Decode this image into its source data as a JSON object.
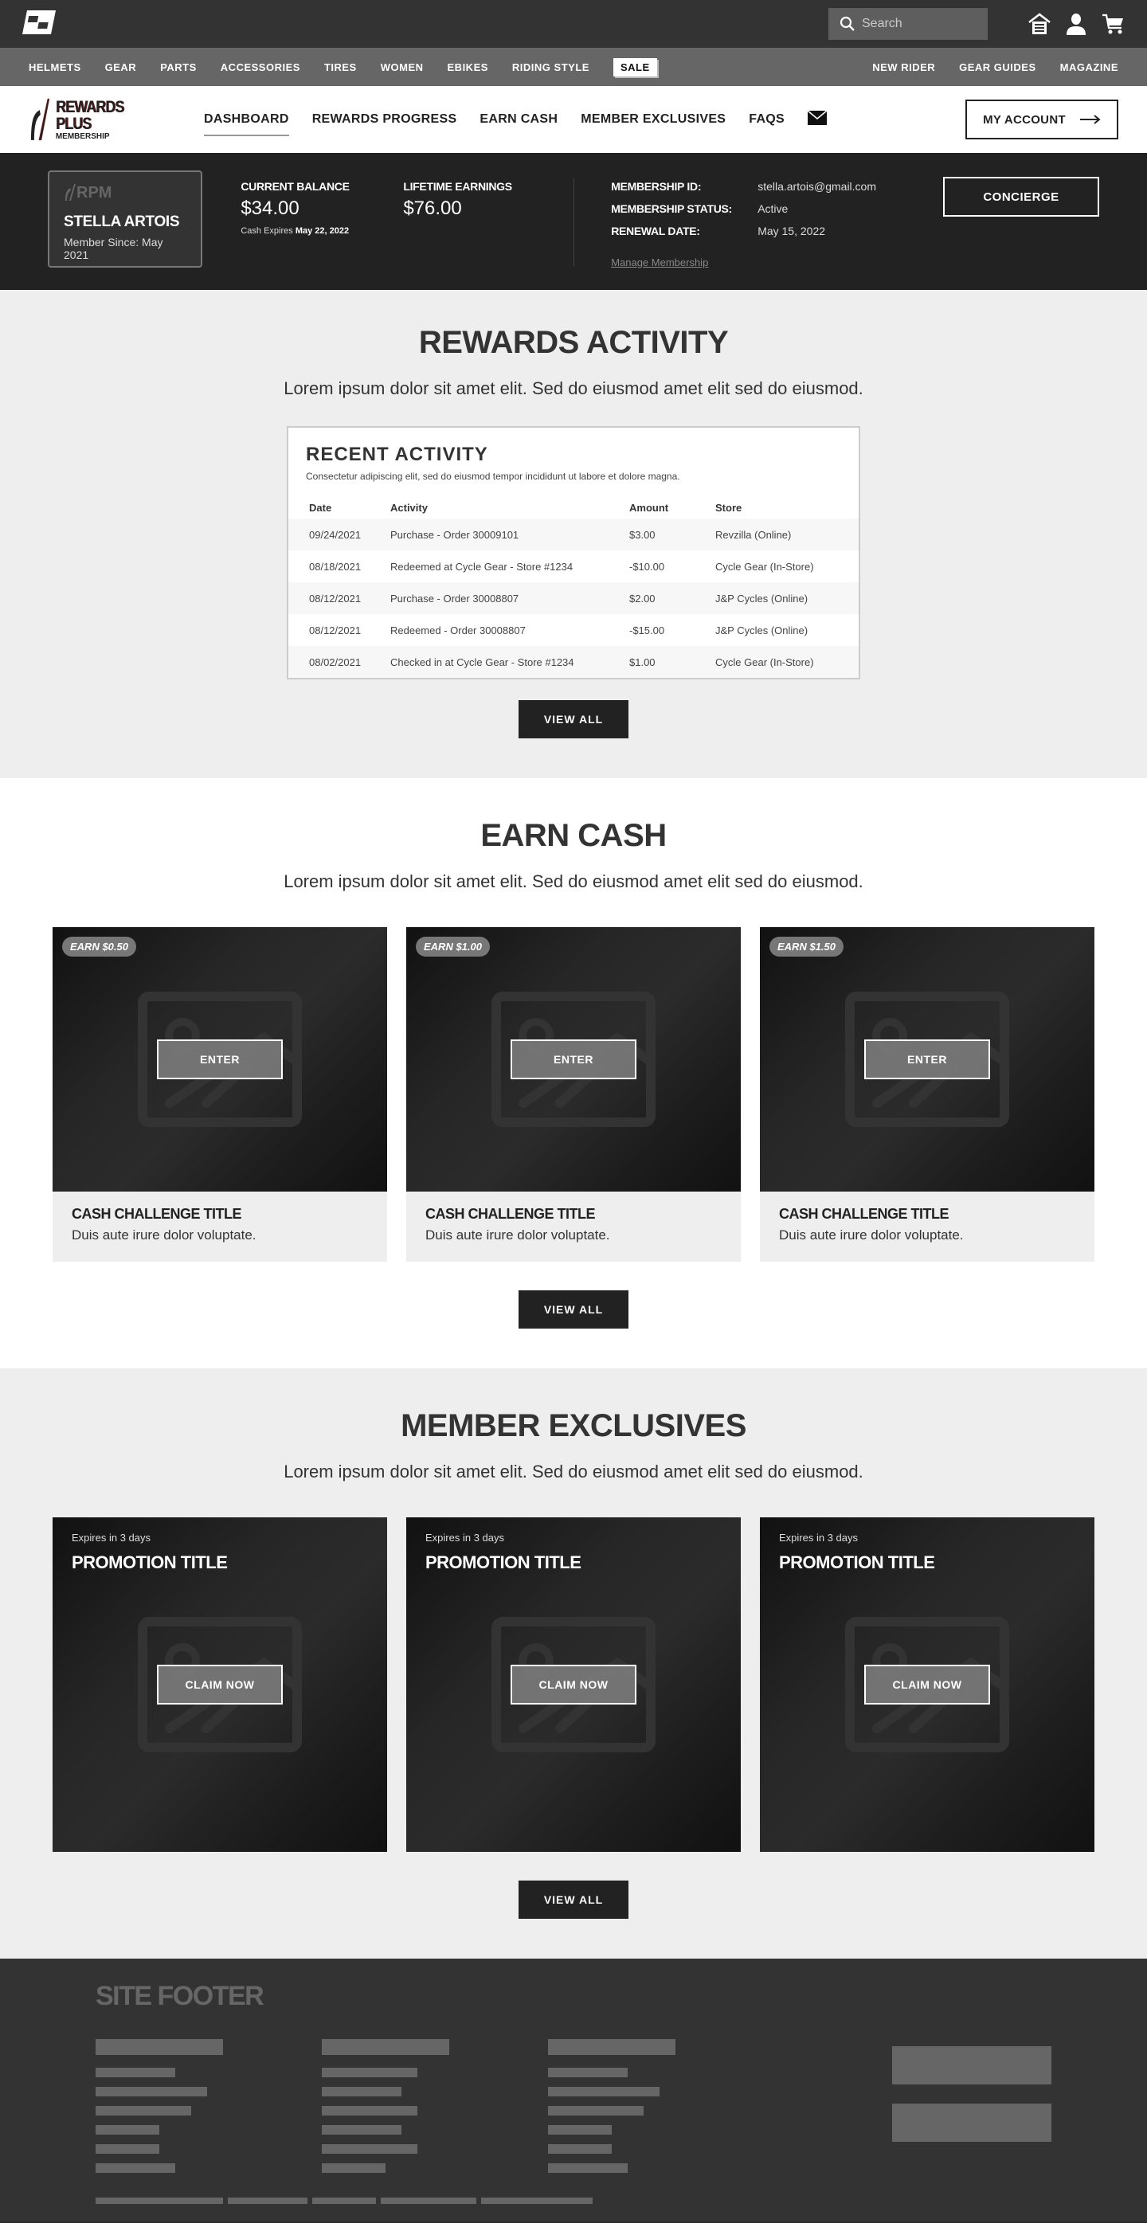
{
  "topbar": {
    "search_placeholder": "Search",
    "icons": [
      "garage-icon",
      "account-icon",
      "cart-icon"
    ]
  },
  "category_nav": {
    "left": [
      "HELMETS",
      "GEAR",
      "PARTS",
      "ACCESSORIES",
      "TIRES",
      "WOMEN",
      "EBIKES",
      "RIDING STYLE"
    ],
    "sale": "SALE",
    "right": [
      "NEW RIDER",
      "GEAR GUIDES",
      "MAGAZINE"
    ]
  },
  "rewards_nav": {
    "logo_main": "REWARDS",
    "logo_plus": "PLUS",
    "logo_sub": "MEMBERSHIP",
    "links": [
      "DASHBOARD",
      "REWARDS PROGRESS",
      "EARN CASH",
      "MEMBER EXCLUSIVES",
      "FAQS"
    ],
    "active": "DASHBOARD",
    "my_account": "MY ACCOUNT"
  },
  "member": {
    "card_logo": "RPM",
    "name": "STELLA ARTOIS",
    "since": "Member Since: May 2021",
    "current_balance_label": "CURRENT BALANCE",
    "current_balance": "$34.00",
    "cash_expires_label": "Cash Expires",
    "cash_expires_date": "May 22, 2022",
    "lifetime_label": "LIFETIME EARNINGS",
    "lifetime": "$76.00",
    "details": [
      {
        "label": "MEMBERSHIP ID:",
        "value": "stella.artois@gmail.com"
      },
      {
        "label": "MEMBERSHIP STATUS:",
        "value": "Active"
      },
      {
        "label": "RENEWAL DATE:",
        "value": "May 15, 2022"
      }
    ],
    "manage_link": "Manage Membership",
    "concierge": "CONCIERGE"
  },
  "rewards_activity": {
    "title": "REWARDS ACTIVITY",
    "subtitle": "Lorem ipsum dolor sit amet elit. Sed do eiusmod amet elit sed do eiusmod.",
    "card_title": "RECENT ACTIVITY",
    "card_desc": "Consectetur adipiscing elit, sed do eiusmod tempor incididunt ut labore et dolore magna.",
    "columns": [
      "Date",
      "Activity",
      "Amount",
      "Store"
    ],
    "rows": [
      [
        "09/24/2021",
        "Purchase - Order 30009101",
        "$3.00",
        "Revzilla (Online)"
      ],
      [
        "08/18/2021",
        "Redeemed at Cycle Gear - Store #1234",
        "-$10.00",
        "Cycle Gear (In-Store)"
      ],
      [
        "08/12/2021",
        "Purchase - Order 30008807",
        "$2.00",
        "J&P Cycles (Online)"
      ],
      [
        "08/12/2021",
        "Redeemed - Order 30008807",
        "-$15.00",
        "J&P Cycles (Online)"
      ],
      [
        "08/02/2021",
        "Checked in at Cycle Gear - Store #1234",
        "$1.00",
        "Cycle Gear (In-Store)"
      ]
    ],
    "view_all": "VIEW ALL"
  },
  "earn_cash": {
    "title": "EARN CASH",
    "subtitle": "Lorem ipsum dolor sit amet elit. Sed do eiusmod amet elit sed do eiusmod.",
    "cards": [
      {
        "badge": "EARN $0.50",
        "cta": "ENTER",
        "title": "CASH CHALLENGE TITLE",
        "desc": "Duis aute irure dolor voluptate."
      },
      {
        "badge": "EARN $1.00",
        "cta": "ENTER",
        "title": "CASH CHALLENGE TITLE",
        "desc": "Duis aute irure dolor voluptate."
      },
      {
        "badge": "EARN $1.50",
        "cta": "ENTER",
        "title": "CASH CHALLENGE TITLE",
        "desc": "Duis aute irure dolor voluptate."
      }
    ],
    "view_all": "VIEW ALL"
  },
  "member_exclusives": {
    "title": "MEMBER EXCLUSIVES",
    "subtitle": "Lorem ipsum dolor sit amet elit. Sed do eiusmod amet elit sed do eiusmod.",
    "cards": [
      {
        "expires": "Expires in 3 days",
        "title": "PROMOTION TITLE",
        "cta": "CLAIM NOW"
      },
      {
        "expires": "Expires in 3 days",
        "title": "PROMOTION TITLE",
        "cta": "CLAIM NOW"
      },
      {
        "expires": "Expires in 3 days",
        "title": "PROMOTION TITLE",
        "cta": "CLAIM NOW"
      }
    ],
    "view_all": "VIEW ALL"
  },
  "footer": {
    "title": "SITE FOOTER"
  }
}
